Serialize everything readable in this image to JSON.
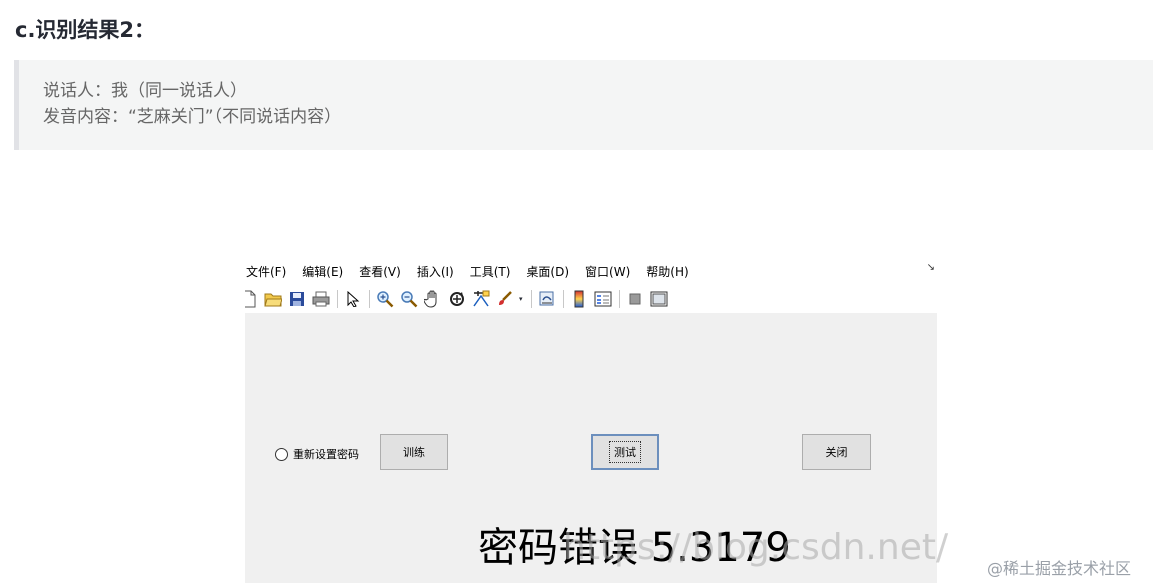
{
  "article": {
    "heading": "c.识别结果2：",
    "quote_lines": [
      "说话人：我（同一说话人）",
      "发音内容：“芝麻关门”（不同说话内容）"
    ]
  },
  "app": {
    "menu": [
      "文件(F)",
      "编辑(E)",
      "查看(V)",
      "插入(I)",
      "工具(T)",
      "桌面(D)",
      "窗口(W)",
      "帮助(H)"
    ],
    "corner_arrow": "↘",
    "toolbar_icons": [
      "new-file-icon",
      "open-folder-icon",
      "save-icon",
      "print-icon",
      "pointer-icon",
      "zoom-in-icon",
      "zoom-out-icon",
      "pan-hand-icon",
      "rotate-icon",
      "data-cursor-icon",
      "brush-icon",
      "link-icon",
      "colorbar-icon",
      "legend-icon",
      "hide-tools-icon",
      "dock-icon"
    ],
    "radio_label": "重新设置密码",
    "buttons": {
      "train": "训练",
      "test": "测试",
      "close": "关闭"
    },
    "result_text": "密码错误 5.3179"
  },
  "watermarks": {
    "url": "https://blog.csdn.net/",
    "site": "@稀土掘金技术社区"
  },
  "colors": {
    "quote_bg": "#f4f5f5",
    "quote_border": "#e1e2e6",
    "window_bg": "#f0f0f0",
    "focus_border": "#6c8fbd"
  }
}
